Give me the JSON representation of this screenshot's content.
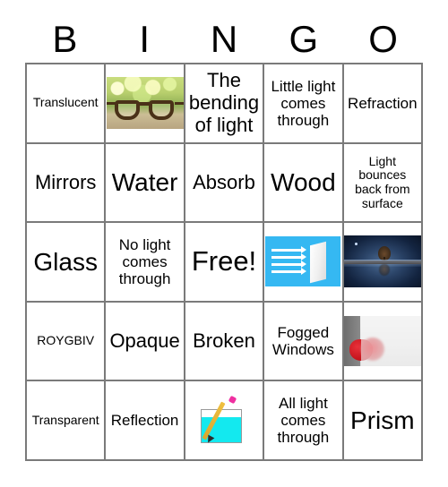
{
  "card": {
    "title": "BINGO",
    "header_letters": [
      "B",
      "I",
      "N",
      "G",
      "O"
    ],
    "grid_rows": 5,
    "grid_cols": 5,
    "border_color": "#7a7a7a",
    "background_color": "#ffffff",
    "text_color": "#000000",
    "free_space_label": "Free!",
    "free_space_position": "row3-col3",
    "cells": [
      {
        "row": 1,
        "col": 1,
        "type": "text",
        "text": "Translucent",
        "size": "xs"
      },
      {
        "row": 1,
        "col": 2,
        "type": "image",
        "text": "",
        "image": "eyeglasses-bokeh-photo",
        "size": "xs"
      },
      {
        "row": 1,
        "col": 3,
        "type": "text",
        "text": "The bending of light",
        "size": "md"
      },
      {
        "row": 1,
        "col": 4,
        "type": "text",
        "text": "Little light comes through",
        "size": "sm"
      },
      {
        "row": 1,
        "col": 5,
        "type": "text",
        "text": "Refraction",
        "size": "sm"
      },
      {
        "row": 2,
        "col": 1,
        "type": "text",
        "text": "Mirrors",
        "size": "md"
      },
      {
        "row": 2,
        "col": 2,
        "type": "text",
        "text": "Water",
        "size": "lg"
      },
      {
        "row": 2,
        "col": 3,
        "type": "text",
        "text": "Absorb",
        "size": "md"
      },
      {
        "row": 2,
        "col": 4,
        "type": "text",
        "text": "Wood",
        "size": "lg"
      },
      {
        "row": 2,
        "col": 5,
        "type": "text",
        "text": "Light bounces back from surface",
        "size": "xs"
      },
      {
        "row": 3,
        "col": 1,
        "type": "text",
        "text": "Glass",
        "size": "lg"
      },
      {
        "row": 3,
        "col": 2,
        "type": "text",
        "text": "No light comes through",
        "size": "sm"
      },
      {
        "row": 3,
        "col": 3,
        "type": "text",
        "text": "Free!",
        "size": "xl"
      },
      {
        "row": 3,
        "col": 4,
        "type": "image",
        "text": "",
        "image": "light-rays-hitting-surface-icon",
        "size": "xs"
      },
      {
        "row": 3,
        "col": 5,
        "type": "image",
        "text": "",
        "image": "tree-reflection-in-water-photo",
        "size": "xs"
      },
      {
        "row": 4,
        "col": 1,
        "type": "text",
        "text": "ROYGBIV",
        "size": "xs"
      },
      {
        "row": 4,
        "col": 2,
        "type": "text",
        "text": "Opaque",
        "size": "md"
      },
      {
        "row": 4,
        "col": 3,
        "type": "text",
        "text": "Broken",
        "size": "md"
      },
      {
        "row": 4,
        "col": 4,
        "type": "text",
        "text": "Fogged Windows",
        "size": "sm"
      },
      {
        "row": 4,
        "col": 5,
        "type": "image",
        "text": "",
        "image": "strawberry-behind-frosted-glass-photo",
        "size": "xs"
      },
      {
        "row": 5,
        "col": 1,
        "type": "text",
        "text": "Transparent",
        "size": "xs"
      },
      {
        "row": 5,
        "col": 2,
        "type": "text",
        "text": "Reflection",
        "size": "sm"
      },
      {
        "row": 5,
        "col": 3,
        "type": "image",
        "text": "",
        "image": "pencil-in-glass-of-water-icon",
        "size": "xs"
      },
      {
        "row": 5,
        "col": 4,
        "type": "text",
        "text": "All light comes through",
        "size": "sm"
      },
      {
        "row": 5,
        "col": 5,
        "type": "text",
        "text": "Prism",
        "size": "lg"
      }
    ]
  }
}
